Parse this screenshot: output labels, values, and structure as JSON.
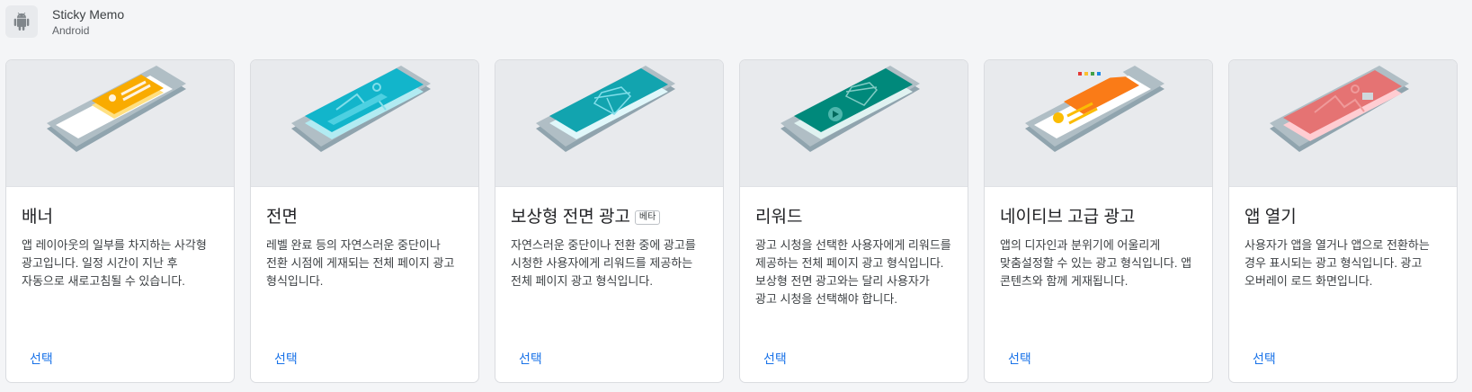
{
  "app": {
    "name": "Sticky Memo",
    "platform": "Android"
  },
  "cards": [
    {
      "title": "배너",
      "badge": "",
      "description": "앱 레이아웃의 일부를 차지하는 사각형 광고입니다. 일정 시간이 지난 후 자동으로 새로고침될 수 있습니다.",
      "action": "선택",
      "illustration": "banner-illustration",
      "accent": "#f9ab00"
    },
    {
      "title": "전면",
      "badge": "",
      "description": "레벨 완료 등의 자연스러운 중단이나 전환 시점에 게재되는 전체 페이지 광고 형식입니다.",
      "action": "선택",
      "illustration": "interstitial-illustration",
      "accent": "#12b5cb"
    },
    {
      "title": "보상형 전면 광고",
      "badge": "베타",
      "description": "자연스러운 중단이나 전환 중에 광고를 시청한 사용자에게 리워드를 제공하는 전체 페이지 광고 형식입니다.",
      "action": "선택",
      "illustration": "rewarded-interstitial-illustration",
      "accent": "#12a4af"
    },
    {
      "title": "리워드",
      "badge": "",
      "description": "광고 시청을 선택한 사용자에게 리워드를 제공하는 전체 페이지 광고 형식입니다. 보상형 전면 광고와는 달리 사용자가 광고 시청을 선택해야 합니다.",
      "action": "선택",
      "illustration": "rewarded-illustration",
      "accent": "#00897b"
    },
    {
      "title": "네이티브 고급 광고",
      "badge": "",
      "description": "앱의 디자인과 분위기에 어울리게 맞춤설정할 수 있는 광고 형식입니다. 앱 콘텐츠와 함께 게재됩니다.",
      "action": "선택",
      "illustration": "native-illustration",
      "accent": "#fa7b17"
    },
    {
      "title": "앱 열기",
      "badge": "",
      "description": "사용자가 앱을 열거나 앱으로 전환하는 경우 표시되는 광고 형식입니다. 광고 오버레이 로드 화면입니다.",
      "action": "선택",
      "illustration": "app-open-illustration",
      "accent": "#e57373"
    }
  ]
}
